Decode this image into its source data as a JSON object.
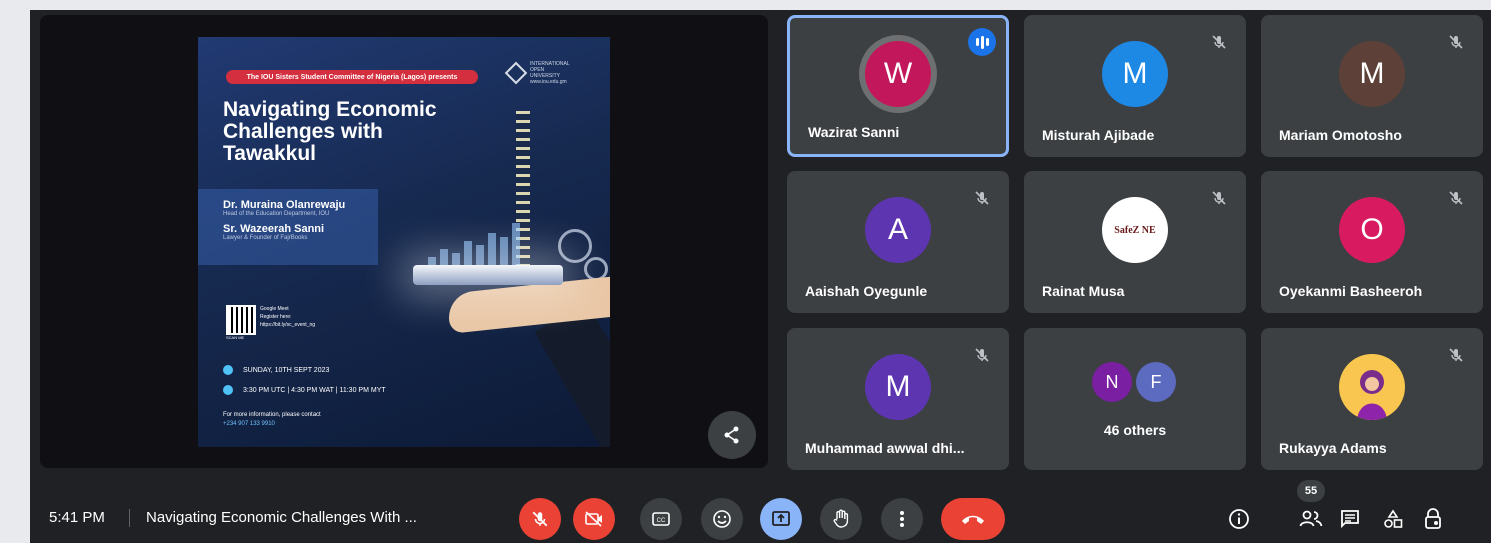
{
  "colors": {
    "accent": "#8ab4f8",
    "end_call": "#ea4335",
    "tile_bg": "#3c4043",
    "bar_bg": "#202124"
  },
  "presentation": {
    "banner": "The IOU Sisters Student Committee of Nigeria (Lagos) presents",
    "org_name": "INTERNATIONAL OPEN UNIVERSITY",
    "org_url": "www.iou.edu.gm",
    "title": "Navigating Economic\nChallenges with\nTawakkul",
    "speakers": [
      {
        "name": "Dr. Muraina Olanrewaju",
        "role": "Head of the Education Department, IOU"
      },
      {
        "name": "Sr. Wazeerah Sanni",
        "role": "Lawyer & Founder of FajrBooks"
      }
    ],
    "qr_label": "SCAN ME",
    "meet_label": "Google Meet",
    "register_label": "Register here:",
    "register_link": "https://bit.ly/sc_event_ng",
    "date": "SUNDAY, 10TH SEPT 2023",
    "times": "3:30 PM UTC | 4:30 PM WAT | 11:30 PM MYT",
    "contact_label": "For more information, please contact",
    "contact_phone": "+234 907 133 9910",
    "share_icon": "share-icon"
  },
  "participants": [
    {
      "initial": "W",
      "name": "Wazirat Sanni",
      "color": "#c2185b",
      "speaking": true
    },
    {
      "initial": "M",
      "name": "Misturah Ajibade",
      "color": "#1e88e5",
      "speaking": false
    },
    {
      "initial": "M",
      "name": "Mariam Omotosho",
      "color": "#5d4037",
      "speaking": false
    },
    {
      "initial": "A",
      "name": "Aaishah Oyegunle",
      "color": "#5e35b1",
      "speaking": false
    },
    {
      "initial": "",
      "name": "Rainat Musa",
      "logo_text": "SafeZ NE",
      "speaking": false
    },
    {
      "initial": "O",
      "name": "Oyekanmi Basheeroh",
      "color": "#d81b60",
      "speaking": false
    },
    {
      "initial": "M",
      "name": "Muhammad awwal dhi...",
      "color": "#5e35b1",
      "speaking": false
    },
    {
      "initial": "",
      "name": "46 others",
      "others": [
        "N",
        "F"
      ]
    },
    {
      "initial": "",
      "name": "Rukayya Adams",
      "speaking": false
    }
  ],
  "bottom_bar": {
    "time": "5:41 PM",
    "meeting_title": "Navigating Economic Challenges With ...",
    "people_count": "55"
  }
}
